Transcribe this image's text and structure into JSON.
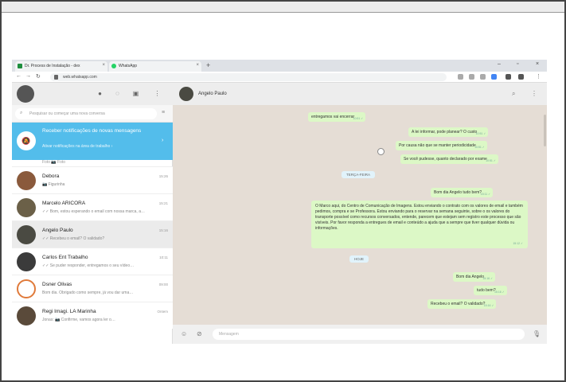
{
  "browser": {
    "tabs": [
      {
        "label": "Dr. Process de Instalação - dex",
        "color": "#1e8e3e"
      },
      {
        "label": "WhatsApp",
        "color": "#25d366"
      }
    ],
    "url": "web.whatsapp.com"
  },
  "sidebar": {
    "search_placeholder": "Pesquisar ou começar uma nova conversa",
    "notification": {
      "title": "Receber notificações de novas mensagens",
      "subtitle": "Ativar notificações na área de trabalho ›"
    },
    "cut_preview": "Foto 📷 Foto",
    "chats": [
      {
        "name": "Debora",
        "preview": "📷 Figurinha",
        "time": "15:26",
        "avatar_color": "#8a5a3c"
      },
      {
        "name": "Marcelo ARICORA",
        "preview": "✓✓ Bom, estou esperando o email com nossa marca, a…",
        "time": "15:21",
        "avatar_color": "#6b6048"
      },
      {
        "name": "Angelo Paulo",
        "preview": "✓✓ Recebeu o email? O validado?",
        "time": "15:16",
        "avatar_color": "#4a4a42"
      },
      {
        "name": "Carlos Ent Trabalho",
        "preview": "✓✓ Se puder responder, entregamos o seu vídeo…",
        "time": "10:11",
        "avatar_color": "#3b3b3b"
      },
      {
        "name": "Dsner Olivas",
        "preview": "Bom dia. Obrigado como sempre, já vou dar uma…",
        "time": "09:00",
        "avatar_color": "#e07a3a"
      },
      {
        "name": "Regi Imagi. LA Marinha",
        "preview": "Jonas: 📷 Confirme, vamos agora ler o…",
        "time": "Ontem",
        "avatar_color": "#5a4a3a"
      }
    ]
  },
  "conversation": {
    "contact_name": "Angelo Paulo",
    "messages": [
      {
        "text": "entregamos vai encerrar",
        "time": "10:51 ✓"
      },
      {
        "text": "A lei informar, pode planear? O custo",
        "time": "10:51 ✓"
      },
      {
        "text": "Por causa não que se manter periodicidade",
        "time": "10:51 ✓"
      },
      {
        "text": "Se você pudesse, quanto declarado por exame",
        "time": "10:51 ✓"
      },
      {
        "text": "Bom dia Angelo tudo bem?",
        "time": "15:11 ✓"
      },
      {
        "text": "O Marco aqui, do Centro de Comunicação de Imagens. Estou enviando o contrato com os valores de email e também pedimos, compra e se Professora. Estou enviando para o reservar na semana seguinte, sobre o os valores do transporte possível como recursos conversados, entende, parecem que estejam sem registro este processo que são visíveis. Por favor responda a entregues de email e conteúdo a ajuda que a sempre que tiver qualquer dúvida ou informações.",
        "time": "15:12 ✓"
      },
      {
        "text": "Bom dia Angelo",
        "time": "15:16 ✓"
      },
      {
        "text": "tudo bem?",
        "time": "15:16 ✓"
      },
      {
        "text": "Recebeu o email? O validado?",
        "time": "15:16 ✓"
      }
    ],
    "day_labels": [
      "TERÇA-FEIRA",
      "HOJE"
    ],
    "input_placeholder": "Mensagem"
  }
}
